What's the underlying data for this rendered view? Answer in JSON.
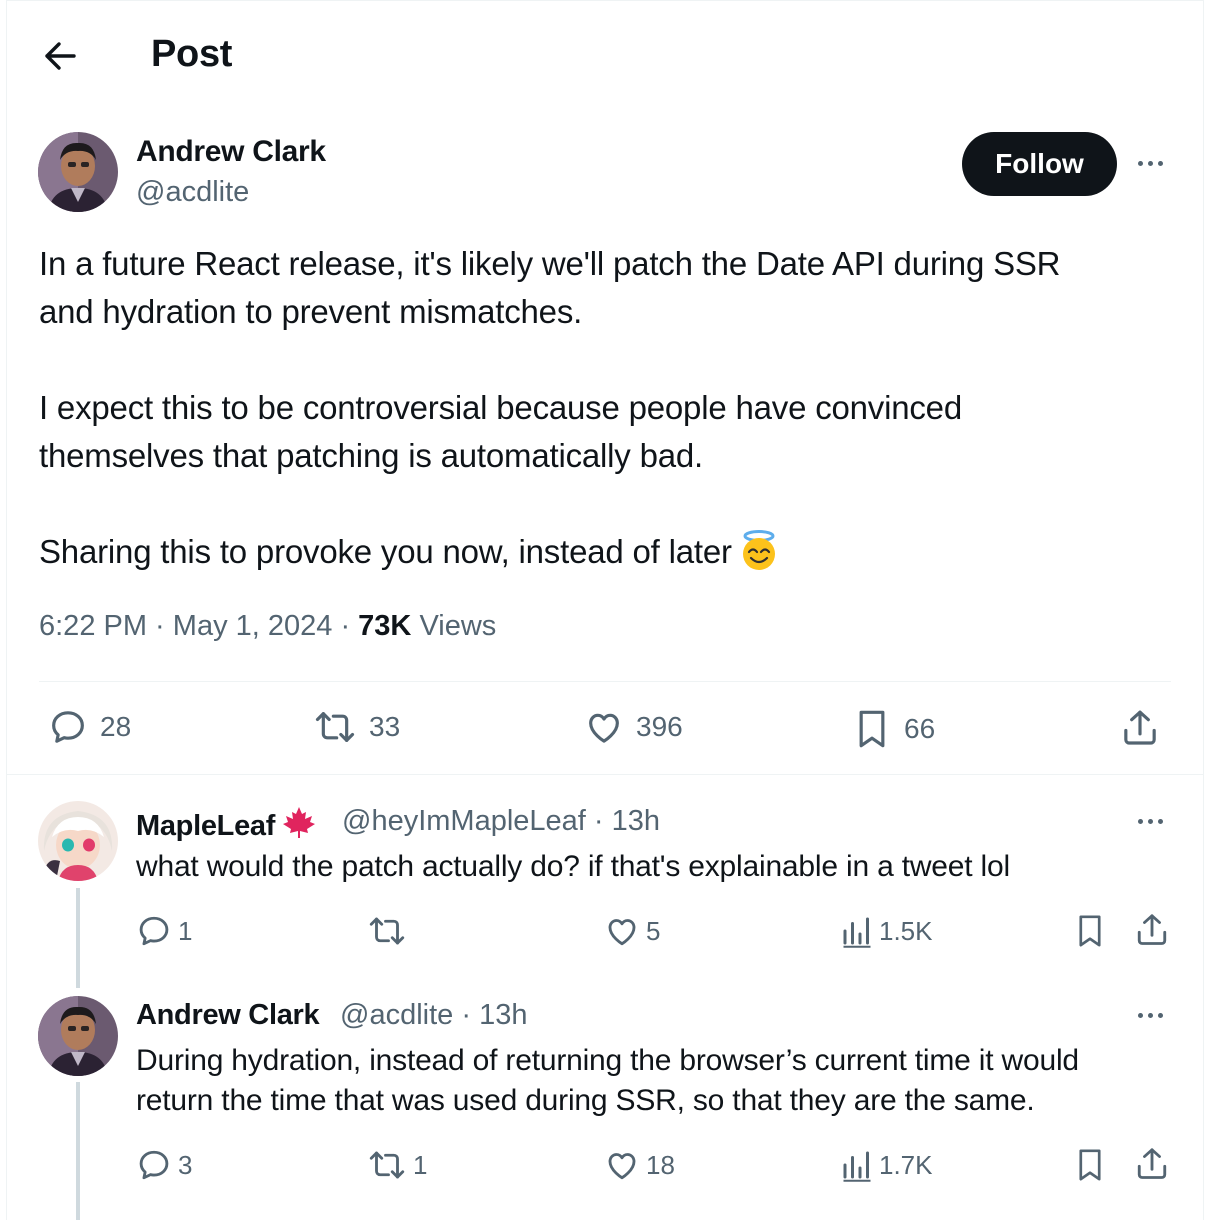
{
  "header": {
    "title": "Post"
  },
  "post": {
    "author": {
      "name": "Andrew Clark",
      "handle": "@acdlite"
    },
    "follow_label": "Follow",
    "text_lines": [
      "In a future React release, it's likely we'll patch the Date API during SSR",
      "and hydration to prevent mismatches.",
      "I expect this to be controversial because people have convinced",
      "themselves that patching is automatically bad.",
      "Sharing this to provoke you now, instead of later"
    ],
    "emoji": "smiling-face-with-halo",
    "time": "6:22 PM",
    "date": "May 1, 2024",
    "views_count": "73K",
    "views_label": "Views",
    "stats": {
      "replies": "28",
      "reposts": "33",
      "likes": "396",
      "bookmarks": "66"
    }
  },
  "replies": [
    {
      "name": "MapleLeaf",
      "flag": "maple-leaf-icon",
      "handle": "@heyImMapleLeaf",
      "age": "13h",
      "text_lines": [
        "what would the patch actually do? if that's explainable in a tweet lol"
      ],
      "stats": {
        "replies": "1",
        "reposts": "",
        "likes": "5",
        "views": "1.5K"
      }
    },
    {
      "name": "Andrew Clark",
      "handle": "@acdlite",
      "age": "13h",
      "text_lines": [
        "During hydration, instead of returning the browser’s current time it would",
        "return the time that was used during SSR, so that they are the same."
      ],
      "stats": {
        "replies": "3",
        "reposts": "1",
        "likes": "18",
        "views": "1.7K"
      }
    }
  ],
  "colors": {
    "text": "#0f1419",
    "secondary": "#536471",
    "divider": "#eff3f4",
    "maple": "#e0245e"
  }
}
